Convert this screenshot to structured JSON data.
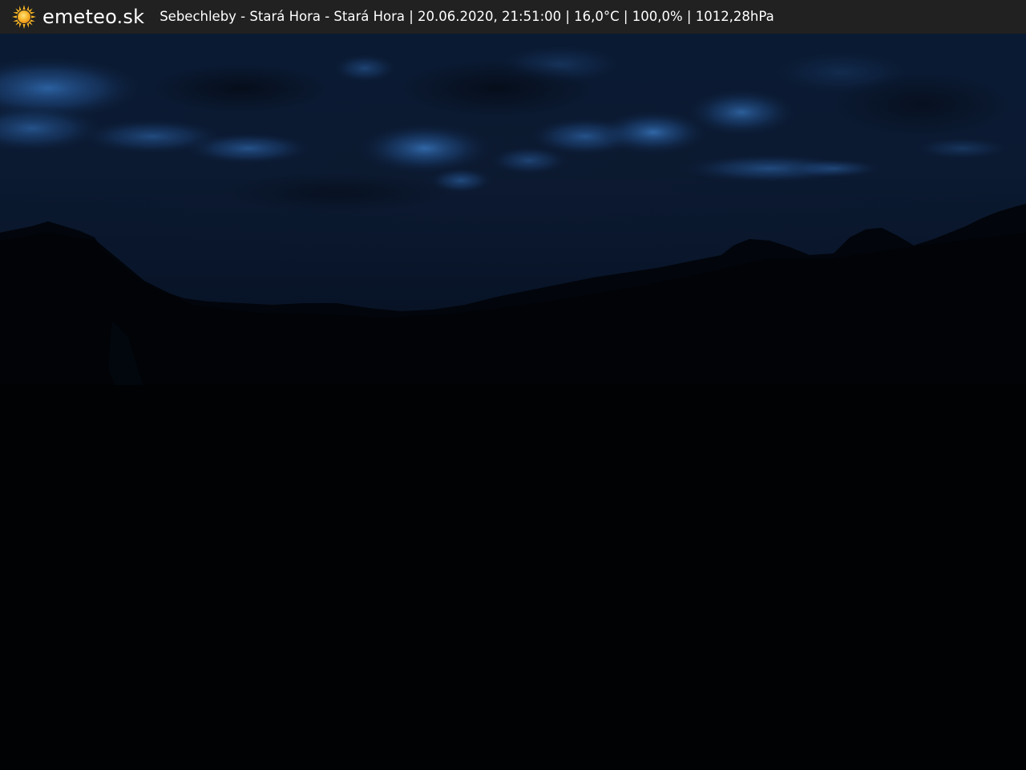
{
  "header": {
    "brand": "emeteo.sk",
    "logo_icon": "sun-icon",
    "caption": "Sebechleby - Stará Hora - Stará Hora | 20.06.2020, 21:51:00 | 16,0°C | 100,0% | 1012,28hPa"
  },
  "colors": {
    "bar_background": "#212121",
    "sun": "#f5b324",
    "sky_dark": "#071327",
    "cloud_highlight": "#2f67aa",
    "ground": "#010203"
  }
}
